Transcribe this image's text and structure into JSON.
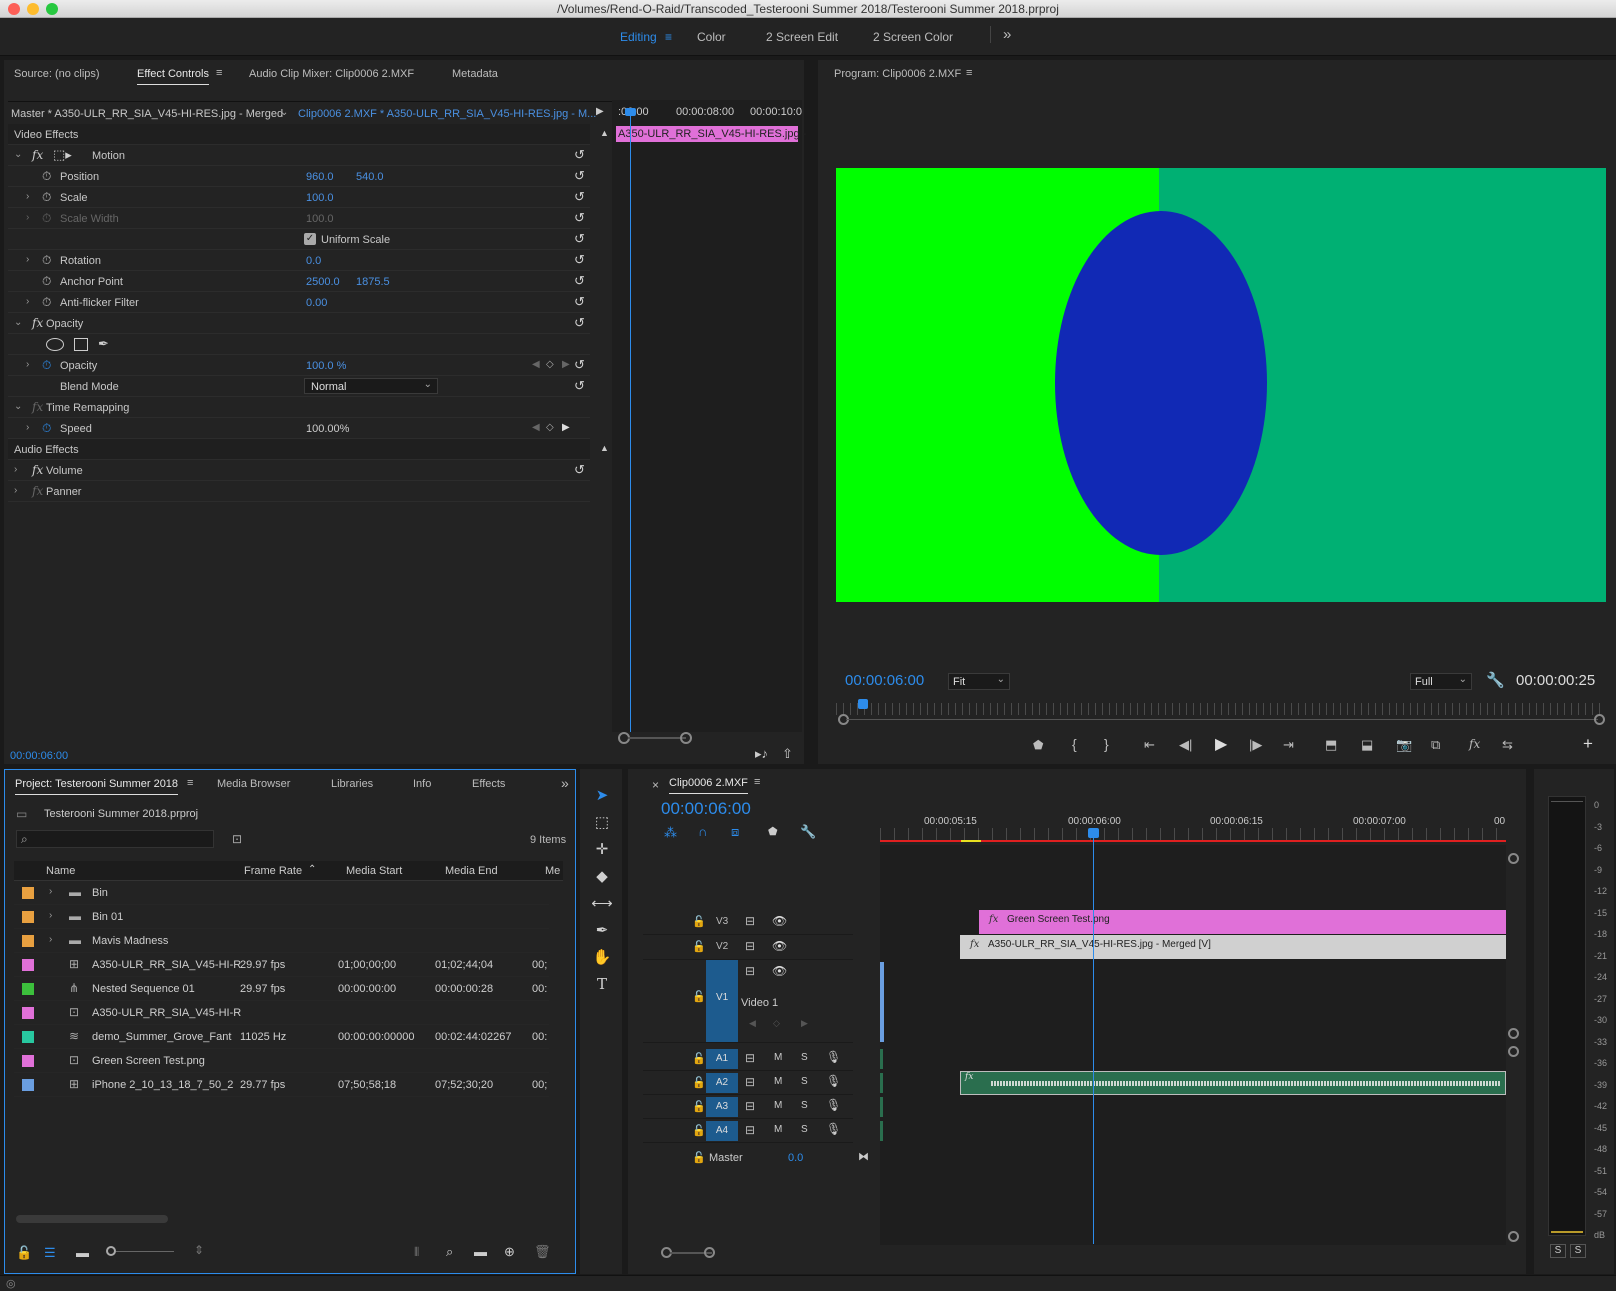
{
  "window_title": "/Volumes/Rend-O-Raid/Transcoded_Testerooni Summer 2018/Testerooni Summer 2018.prproj",
  "workspaces": [
    "Editing",
    "Color",
    "2 Screen Edit",
    "2 Screen Color"
  ],
  "source_panel": {
    "tabs": [
      "Source: (no clips)",
      "Effect Controls",
      "Audio Clip Mixer: Clip0006 2.MXF",
      "Metadata"
    ],
    "master_label": "Master * A350-ULR_RR_SIA_V45-HI-RES.jpg - Merged",
    "clip_label": "Clip0006 2.MXF * A350-ULR_RR_SIA_V45-HI-RES.jpg - M...",
    "mini_times": [
      ":06:00",
      "00:00:08:00",
      "00:00:10:0"
    ],
    "mini_clip": "A350-ULR_RR_SIA_V45-HI-RES.jpg -",
    "video_effects": "Video Effects",
    "motion": "Motion",
    "position": {
      "label": "Position",
      "x": "960.0",
      "y": "540.0"
    },
    "scale": {
      "label": "Scale",
      "value": "100.0"
    },
    "scale_width": {
      "label": "Scale Width",
      "value": "100.0"
    },
    "uniform_scale": "Uniform Scale",
    "rotation": {
      "label": "Rotation",
      "value": "0.0"
    },
    "anchor": {
      "label": "Anchor Point",
      "x": "2500.0",
      "y": "1875.5"
    },
    "antiflicker": {
      "label": "Anti-flicker Filter",
      "value": "0.00"
    },
    "opacity_group": "Opacity",
    "opacity": {
      "label": "Opacity",
      "value": "100.0 %"
    },
    "blend": {
      "label": "Blend Mode",
      "value": "Normal"
    },
    "time_remap": "Time Remapping",
    "speed": {
      "label": "Speed",
      "value": "100.00%"
    },
    "audio_effects": "Audio Effects",
    "volume": "Volume",
    "panner": "Panner",
    "timecode": "00:00:06:00"
  },
  "program": {
    "title": "Program: Clip0006 2.MXF",
    "timecode": "00:00:06:00",
    "fit": "Fit",
    "quality": "Full",
    "duration": "00:00:00:25",
    "colors": {
      "left": "#00ff00",
      "right": "#00b073",
      "ellipse": "#1129b5"
    }
  },
  "project": {
    "tabs": [
      "Project: Testerooni Summer 2018",
      "Media Browser",
      "Libraries",
      "Info",
      "Effects"
    ],
    "file": "Testerooni Summer 2018.prproj",
    "items_count": "9 Items",
    "columns": [
      "Name",
      "Frame Rate",
      "Media Start",
      "Media End",
      "Me"
    ],
    "rows": [
      {
        "color": "#e8a040",
        "name": "Bin",
        "rate": "",
        "start": "",
        "end": "",
        "extra": ""
      },
      {
        "color": "#e8a040",
        "name": "Bin 01",
        "rate": "",
        "start": "",
        "end": "",
        "extra": ""
      },
      {
        "color": "#e8a040",
        "name": "Mavis Madness",
        "rate": "",
        "start": "",
        "end": "",
        "extra": ""
      },
      {
        "color": "#e070d8",
        "name": "A350-ULR_RR_SIA_V45-HI-R",
        "rate": "29.97 fps",
        "start": "01;00;00;00",
        "end": "01;02;44;04",
        "extra": "00;"
      },
      {
        "color": "#3cbf3c",
        "name": "Nested Sequence 01",
        "rate": "29.97 fps",
        "start": "00:00:00:00",
        "end": "00:00:00:28",
        "extra": "00:"
      },
      {
        "color": "#e070d8",
        "name": "A350-ULR_RR_SIA_V45-HI-R",
        "rate": "",
        "start": "",
        "end": "",
        "extra": ""
      },
      {
        "color": "#28c8a0",
        "name": "demo_Summer_Grove_Fant",
        "rate": "11025 Hz",
        "start": "00:00:00:00000",
        "end": "00:02:44:02267",
        "extra": "00:"
      },
      {
        "color": "#e070d8",
        "name": "Green Screen Test.png",
        "rate": "",
        "start": "",
        "end": "",
        "extra": ""
      },
      {
        "color": "#6a9ee0",
        "name": "iPhone 2_10_13_18_7_50_2",
        "rate": "29.77 fps",
        "start": "07;50;58;18",
        "end": "07;52;30;20",
        "extra": "00;"
      }
    ]
  },
  "timeline": {
    "title": "Clip0006 2.MXF",
    "timecode": "00:00:06:00",
    "ruler": [
      "00:00:05:15",
      "00:00:06:00",
      "00:00:06:15",
      "00:00:07:00",
      "00"
    ],
    "tracks": {
      "v3": "V3",
      "v2": "V2",
      "v1": "V1",
      "video1": "Video 1",
      "a1": "A1",
      "a2": "A2",
      "a3": "A3",
      "a4": "A4",
      "master": "Master",
      "master_val": "0.0"
    },
    "clip_v3": "Green Screen Test.png",
    "clip_v2": "A350-ULR_RR_SIA_V45-HI-RES.jpg - Merged [V]",
    "m": "M",
    "s": "S"
  },
  "meter": {
    "labels": [
      "0",
      "-3",
      "-6",
      "-9",
      "-12",
      "-15",
      "-18",
      "-21",
      "-24",
      "-27",
      "-30",
      "-33",
      "-36",
      "-39",
      "-42",
      "-45",
      "-48",
      "-51",
      "-54",
      "-57",
      "dB"
    ],
    "solo": [
      "S",
      "S"
    ]
  }
}
